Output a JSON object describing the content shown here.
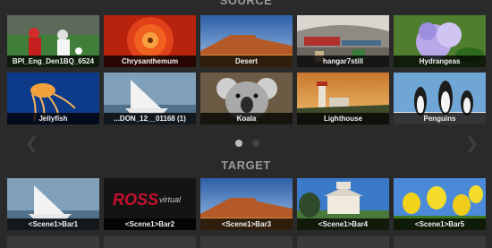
{
  "source": {
    "header": "SOURCE",
    "items": [
      {
        "label": "BPI_Eng_Den1BQ_6524",
        "thumb": "soccer"
      },
      {
        "label": "Chrysanthemum",
        "thumb": "chrysanthemum"
      },
      {
        "label": "Desert",
        "thumb": "desert"
      },
      {
        "label": "hangar7still",
        "thumb": "hangar"
      },
      {
        "label": "Hydrangeas",
        "thumb": "hydrangeas"
      },
      {
        "label": "Jellyfish",
        "thumb": "jellyfish"
      },
      {
        "label": "...DON_12__01168 (1)",
        "thumb": "sailboat"
      },
      {
        "label": "Koala",
        "thumb": "koala"
      },
      {
        "label": "Lighthouse",
        "thumb": "lighthouse"
      },
      {
        "label": "Penguins",
        "thumb": "penguins"
      }
    ]
  },
  "target": {
    "header": "TARGET",
    "items": [
      {
        "label": "<Scene1>Bar1",
        "thumb": "sailboat"
      },
      {
        "label": "<Scene1>Bar2",
        "thumb": "ross",
        "logo_text": "ROSS",
        "logo_sub": "virtual"
      },
      {
        "label": "<Scene1>Bar3",
        "thumb": "desert"
      },
      {
        "label": "<Scene1>Bar4",
        "thumb": "building"
      },
      {
        "label": "<Scene1>Bar5",
        "thumb": "tulips"
      }
    ]
  },
  "pager": {
    "pages": 2,
    "current": 1,
    "prev_icon": "chevron-left-icon",
    "next_icon": "chevron-right-icon"
  },
  "colors": {
    "background": "#2a2a2a",
    "caption_bg": "#000000",
    "header_text": "#9a9a9a",
    "ross_red": "#c8102e"
  }
}
